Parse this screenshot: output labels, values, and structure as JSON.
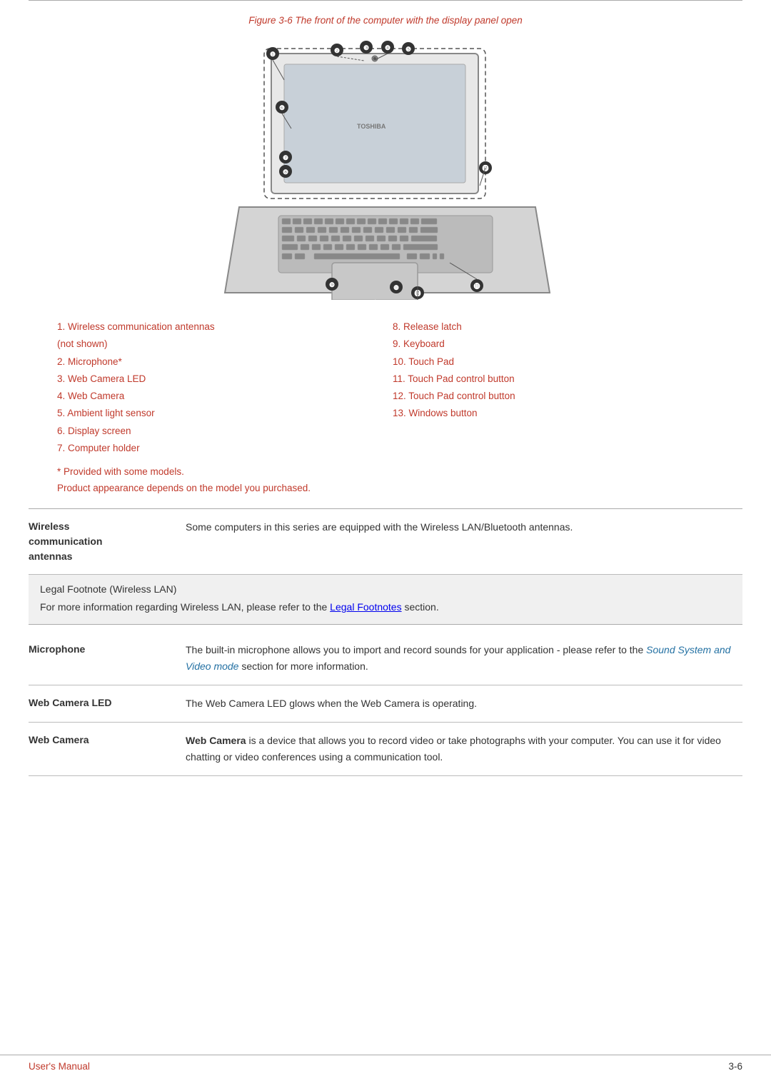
{
  "page": {
    "top_border": true,
    "figure": {
      "caption": "Figure 3-6 The front of the computer with the display panel open"
    },
    "parts_left": [
      "1. Wireless communication antennas",
      "(not shown)",
      "2. Microphone*",
      "3. Web Camera LED",
      "4. Web Camera",
      "5. Ambient light sensor",
      "6. Display screen",
      "7. Computer holder"
    ],
    "parts_right": [
      "8. Release latch",
      "9. Keyboard",
      "10. Touch Pad",
      "11. Touch Pad control button",
      "12. Touch Pad control button",
      "13. Windows button"
    ],
    "notes": [
      "* Provided with some models.",
      "Product appearance depends on the model you purchased."
    ],
    "sections": [
      {
        "id": "wireless",
        "term_line1": "Wireless",
        "term_line2": "communication",
        "term_line3": "antennas",
        "definition": "Some computers in this series are equipped with the Wireless LAN/Bluetooth antennas.",
        "has_legal": true,
        "legal_title": "Legal Footnote (Wireless LAN)",
        "legal_text_before": "For more information regarding Wireless LAN, please refer to the ",
        "legal_link": "Legal Footnotes",
        "legal_text_after": " section."
      },
      {
        "id": "microphone",
        "term": "Microphone",
        "definition_before": "The built-in microphone allows you to import and record sounds for your application - please refer to the ",
        "def_link": "Sound System and Video mode",
        "definition_after": " section for more information."
      },
      {
        "id": "web-camera-led",
        "term": "Web Camera LED",
        "definition": "The Web Camera LED glows when the Web Camera is operating."
      },
      {
        "id": "web-camera",
        "term": "Web Camera",
        "definition_bold": "Web Camera",
        "definition_rest": " is a device that allows you to record video or take photographs with your computer. You can use it for video chatting or video conferences using a communication tool."
      }
    ],
    "footer": {
      "left": "User's Manual",
      "right": "3-6"
    }
  }
}
